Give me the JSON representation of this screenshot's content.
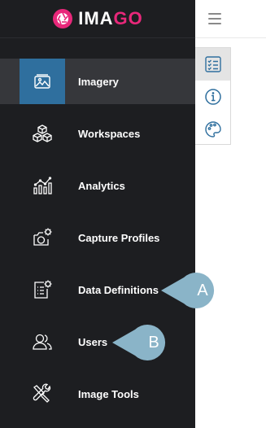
{
  "brand": {
    "prefix": "IMA",
    "accent": "GO",
    "accent_color": "#e8287a"
  },
  "sidebar": {
    "items": [
      {
        "label": "Imagery",
        "icon": "imagery-icon",
        "active": true
      },
      {
        "label": "Workspaces",
        "icon": "workspaces-icon",
        "active": false
      },
      {
        "label": "Analytics",
        "icon": "analytics-icon",
        "active": false
      },
      {
        "label": "Capture Profiles",
        "icon": "capture-profiles-icon",
        "active": false
      },
      {
        "label": "Data Definitions",
        "icon": "data-definitions-icon",
        "active": false
      },
      {
        "label": "Users",
        "icon": "users-icon",
        "active": false
      },
      {
        "label": "Image Tools",
        "icon": "image-tools-icon",
        "active": false
      }
    ]
  },
  "header": {
    "menu_icon": "hamburger-icon"
  },
  "toolstrip": {
    "tools": [
      {
        "icon": "checklist-icon",
        "active": true
      },
      {
        "icon": "info-icon",
        "active": false
      },
      {
        "icon": "palette-icon",
        "active": false
      }
    ]
  },
  "callouts": [
    {
      "label": "A",
      "color": "#8ab4c8"
    },
    {
      "label": "B",
      "color": "#8ab4c8"
    }
  ]
}
